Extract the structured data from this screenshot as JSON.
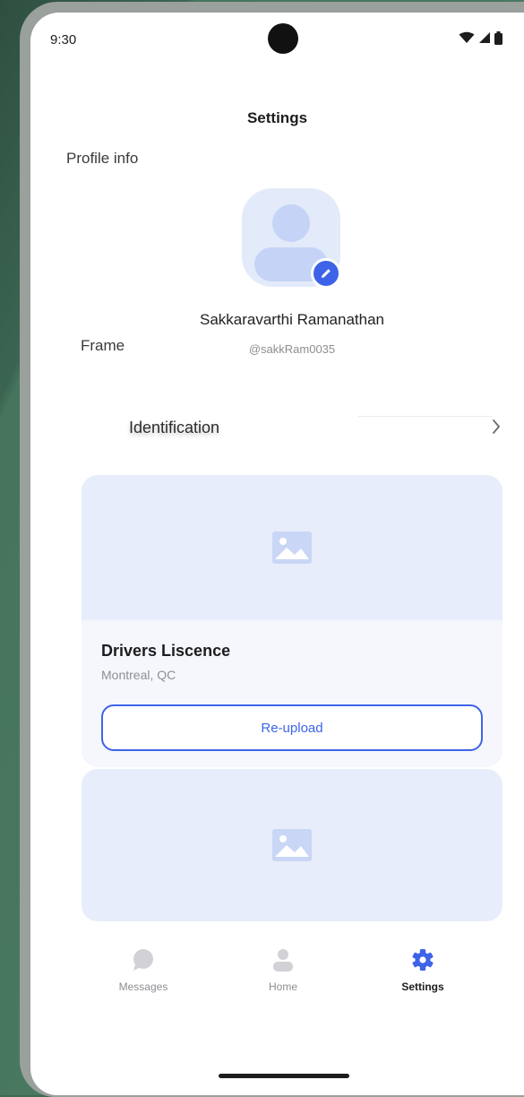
{
  "status_bar": {
    "time": "9:30"
  },
  "page": {
    "title": "Settings",
    "section_label": "Profile info",
    "frame_label": "Frame"
  },
  "profile": {
    "name": "Sakkaravarthi Ramanathan",
    "handle": "@sakkRam0035"
  },
  "identification": {
    "label": "Identification"
  },
  "documents": [
    {
      "title": "Drivers Liscence",
      "location": "Montreal, QC",
      "action_label": "Re-upload"
    }
  ],
  "bottom_nav": {
    "items": [
      {
        "label": "Messages",
        "icon": "chat-bubble-icon",
        "active": false
      },
      {
        "label": "Home",
        "icon": "person-icon",
        "active": false
      },
      {
        "label": "Settings",
        "icon": "gear-icon",
        "active": true
      }
    ]
  },
  "colors": {
    "accent": "#3d64e8",
    "placeholder": "#e8edfb",
    "card": "#f5f7fd",
    "inactive_icon": "#d1d1d6"
  }
}
